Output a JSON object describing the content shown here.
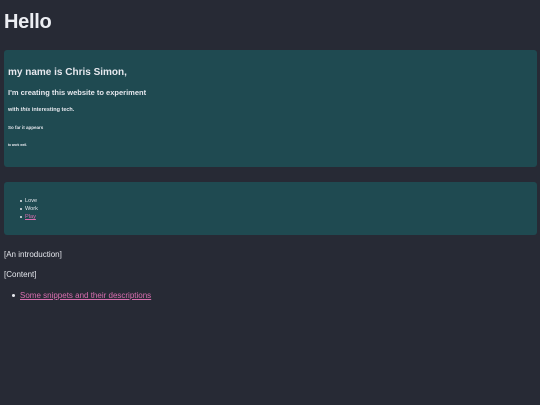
{
  "page": {
    "title": "Hello"
  },
  "intro": {
    "line1": "my name is Chris Simon,",
    "line2": "I'm creating this website to experiment",
    "line3_prefix": "with ",
    "line3_em": "this",
    "line3_suffix": " interesting tech.",
    "line4": "So far it appears",
    "line5": "to work well."
  },
  "nav": {
    "items": [
      {
        "label": "Love"
      },
      {
        "label": "Work"
      },
      {
        "label": "Play"
      }
    ]
  },
  "sections": {
    "introduction": "[An introduction]",
    "content": "[Content]",
    "content_items": [
      {
        "label": "Some snippets and their descriptions"
      }
    ]
  },
  "colors": {
    "background": "#272a35",
    "panel": "#1f4a51",
    "link": "#d96fb0"
  }
}
